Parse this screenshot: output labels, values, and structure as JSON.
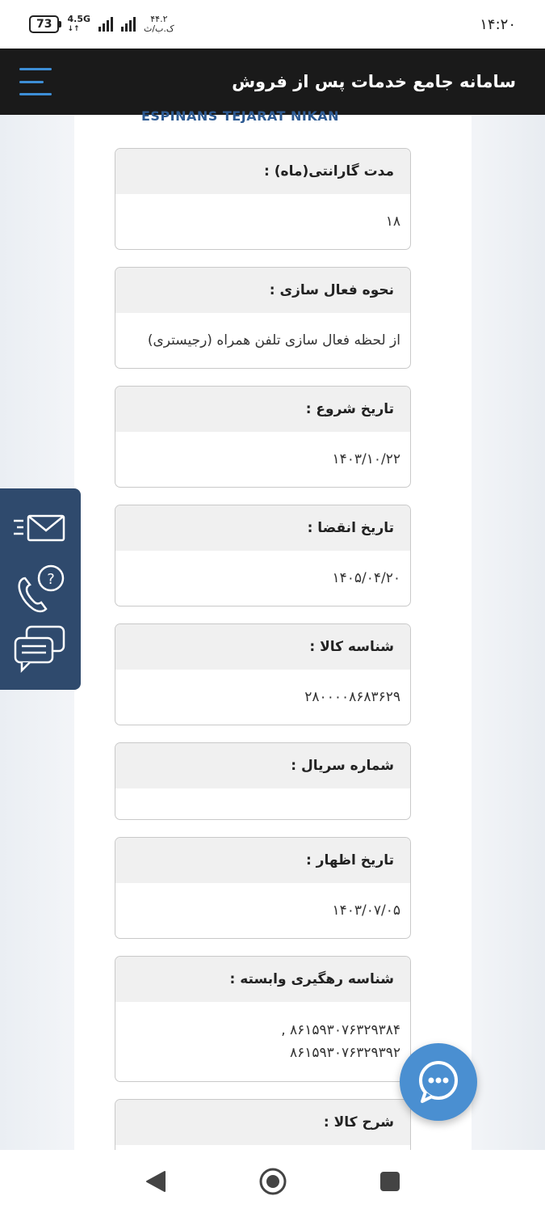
{
  "status_bar": {
    "battery": "73",
    "network": "4.5G",
    "speed_value": "۴۴.۲",
    "speed_unit": "ک.ب/ث",
    "time": "۱۴:۲۰"
  },
  "header": {
    "title": "سامانه جامع خدمات پس از فروش"
  },
  "company_name": "ESPINANS TEJARAT NIKAN",
  "fields": [
    {
      "label": "مدت گارانتی(ماه) :",
      "value": "۱۸"
    },
    {
      "label": "نحوه فعال سازی :",
      "value": "از لحظه فعال سازی تلفن همراه (رجیستری)"
    },
    {
      "label": "تاریخ شروع :",
      "value": "۱۴۰۳/۱۰/۲۲"
    },
    {
      "label": "تاریخ انقضا :",
      "value": "۱۴۰۵/۰۴/۲۰"
    },
    {
      "label": "شناسه کالا :",
      "value": "۲۸۰۰۰۰۸۶۸۳۶۲۹"
    },
    {
      "label": "شماره سریال :",
      "value": ""
    },
    {
      "label": "تاریخ اظهار :",
      "value": "۱۴۰۳/۰۷/۰۵"
    },
    {
      "label": "شناسه رهگیری وابسته :",
      "value_line1": "۸۶۱۵۹۳۰۷۶۳۲۹۳۸۴ ,",
      "value_line2": "۸۶۱۵۹۳۰۷۶۳۲۹۳۹۲"
    },
    {
      "label": "شرح کالا :",
      "value": ""
    }
  ],
  "colors": {
    "header_bg": "#1a1a1a",
    "menu_accent": "#3d8ed6",
    "side_widget_bg": "#2f4a6d",
    "chat_fab_bg": "#4a8fd1",
    "company_text": "#2e5b93"
  },
  "icons": {
    "menu": "hamburger-menu-icon",
    "email": "email-icon",
    "phone_help": "phone-help-icon",
    "chat": "chat-icon",
    "chat_fab": "chat-bubble-icon",
    "nav_back": "back-triangle-icon",
    "nav_home": "home-circle-icon",
    "nav_recent": "recent-square-icon"
  }
}
